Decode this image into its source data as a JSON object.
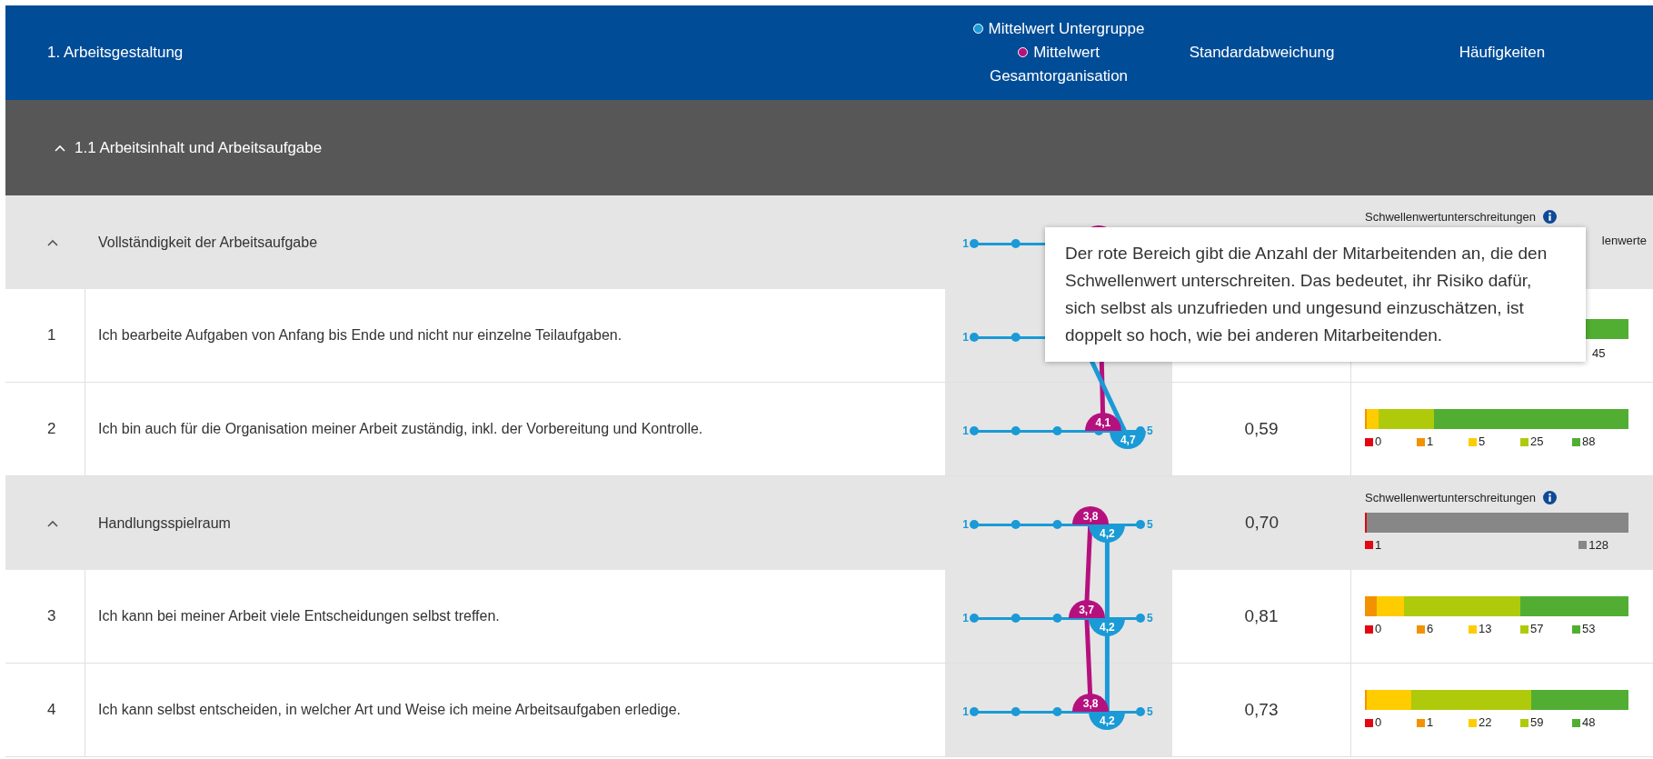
{
  "header": {
    "title": "1. Arbeitsgestaltung",
    "legend": [
      {
        "label": "Mittelwert Untergruppe",
        "color": "#1a9ad6"
      },
      {
        "label": "Mittelwert Gesamtorganisation",
        "color": "#b5117e"
      }
    ],
    "columns": [
      "Standardabweichung",
      "Häufigkeiten"
    ]
  },
  "section": {
    "title": "1.1 Arbeitsinhalt und Arbeitsaufgabe",
    "expanded": true
  },
  "rows": [
    {
      "kind": "group",
      "title": "Vollständigkeit der Arbeitsaufgabe",
      "expanded": true,
      "axis": {
        "min": "1"
      },
      "total": {
        "level": 0.75
      },
      "frequencies": {
        "label": "Schwellenwertunterschreitungen",
        "note": "lenwerte"
      }
    },
    {
      "kind": "item",
      "number": "1",
      "text": "Ich bearbeite Aufgaben von Anfang bis Ende und nicht nur einzelne Teilaufgaben.",
      "axis": {
        "min": "1"
      },
      "subgroup": {
        "level": 0.66
      },
      "frequencies": {
        "segments": [
          {
            "color": "#52ae32"
          }
        ],
        "tail_count": "45"
      }
    },
    {
      "kind": "item",
      "number": "2",
      "text": "Ich bin auch für die Organisation meiner Arbeit zuständig, inkl. der Vorbereitung und Kontrolle.",
      "axis": {
        "min": "1",
        "max": "5"
      },
      "total": {
        "level": 0.775,
        "label": "4,1"
      },
      "subgroup": {
        "level": 0.925,
        "label": "4,7"
      },
      "std": "0,59",
      "frequencies": {
        "segments": [
          {
            "color": "#e30613",
            "count": "0"
          },
          {
            "color": "#f39200",
            "count": "1"
          },
          {
            "color": "#ffcc00",
            "count": "5"
          },
          {
            "color": "#afca0b",
            "count": "25"
          },
          {
            "color": "#52ae32",
            "count": "88"
          }
        ]
      }
    },
    {
      "kind": "group",
      "title": "Handlungsspielraum",
      "expanded": true,
      "axis": {
        "min": "1",
        "max": "5"
      },
      "total": {
        "level": 0.7,
        "label": "3,8"
      },
      "subgroup": {
        "level": 0.8,
        "label": "4,2"
      },
      "std": "0,70",
      "frequencies": {
        "label": "Schwellenwertunterschreitungen",
        "segments": [
          {
            "color": "#e30613",
            "count": "1"
          },
          {
            "color": "#878787",
            "count": "128"
          }
        ]
      }
    },
    {
      "kind": "item",
      "number": "3",
      "text": "Ich kann bei meiner Arbeit viele Entscheidungen selbst treffen.",
      "axis": {
        "min": "1",
        "max": "5"
      },
      "total": {
        "level": 0.675,
        "label": "3,7"
      },
      "subgroup": {
        "level": 0.8,
        "label": "4,2"
      },
      "std": "0,81",
      "frequencies": {
        "segments": [
          {
            "color": "#e30613",
            "count": "0"
          },
          {
            "color": "#f39200",
            "count": "6"
          },
          {
            "color": "#ffcc00",
            "count": "13"
          },
          {
            "color": "#afca0b",
            "count": "57"
          },
          {
            "color": "#52ae32",
            "count": "53"
          }
        ]
      }
    },
    {
      "kind": "item",
      "number": "4",
      "text": "Ich kann selbst entscheiden, in welcher Art und Weise ich meine Arbeitsaufgaben erledige.",
      "axis": {
        "min": "1",
        "max": "5"
      },
      "total": {
        "level": 0.7,
        "label": "3,8"
      },
      "subgroup": {
        "level": 0.8,
        "label": "4,2"
      },
      "std": "0,73",
      "frequencies": {
        "segments": [
          {
            "color": "#e30613",
            "count": "0"
          },
          {
            "color": "#f39200",
            "count": "1"
          },
          {
            "color": "#ffcc00",
            "count": "22"
          },
          {
            "color": "#afca0b",
            "count": "59"
          },
          {
            "color": "#52ae32",
            "count": "48"
          }
        ]
      }
    }
  ],
  "tooltip": {
    "text": "Der rote Bereich gibt die Anzahl der Mitarbeitenden an, die den Schwellenwert unterschreiten. Das bedeutet, ihr Risiko dafür, sich selbst als unzufrieden und ungesund einzuschätzen, ist doppelt so hoch, wie bei anderen Mitarbeitenden."
  }
}
